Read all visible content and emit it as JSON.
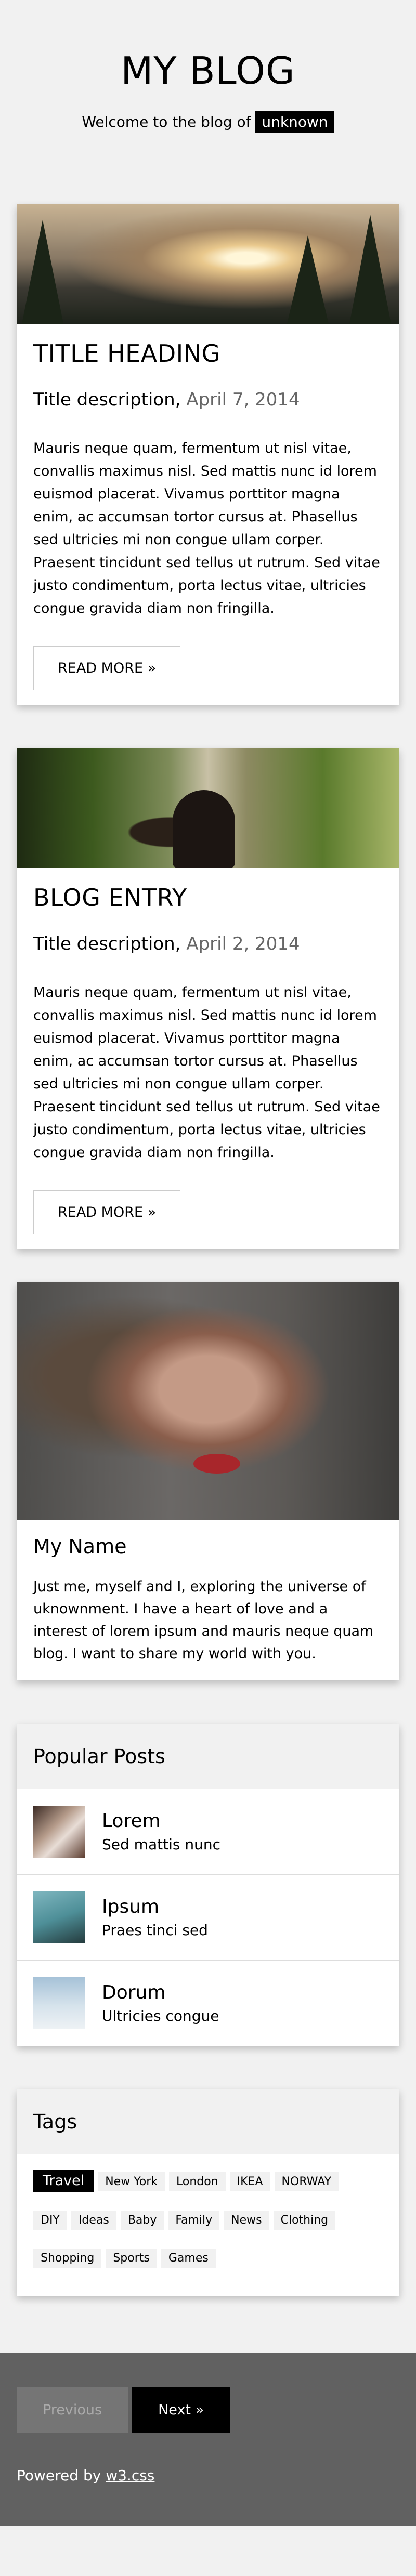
{
  "header": {
    "title": "MY BLOG",
    "welcome_text": "Welcome to the blog of",
    "user_badge": "unknown"
  },
  "entries": [
    {
      "title": "TITLE HEADING",
      "subtitle": "Title description,",
      "date": "April 7, 2014",
      "body": "Mauris neque quam, fermentum ut nisl vitae, convallis maximus nisl. Sed mattis nunc id lorem euismod placerat. Vivamus porttitor magna enim, ac accumsan tortor cursus at. Phasellus sed ultricies mi non congue ullam corper. Praesent tincidunt sed tellus ut rutrum. Sed vitae justo condimentum, porta lectus vitae, ultricies congue gravida diam non fringilla.",
      "button": "READ MORE »"
    },
    {
      "title": "BLOG ENTRY",
      "subtitle": "Title description,",
      "date": "April 2, 2014",
      "body": "Mauris neque quam, fermentum ut nisl vitae, convallis maximus nisl. Sed mattis nunc id lorem euismod placerat. Vivamus porttitor magna enim, ac accumsan tortor cursus at. Phasellus sed ultricies mi non congue ullam corper. Praesent tincidunt sed tellus ut rutrum. Sed vitae justo condimentum, porta lectus vitae, ultricies congue gravida diam non fringilla.",
      "button": "READ MORE »"
    }
  ],
  "profile": {
    "name": "My Name",
    "bio": "Just me, myself and I, exploring the universe of uknownment. I have a heart of love and a interest of lorem ipsum and mauris neque quam blog. I want to share my world with you."
  },
  "popular_posts": {
    "heading": "Popular Posts",
    "items": [
      {
        "title": "Lorem",
        "subtitle": "Sed mattis nunc"
      },
      {
        "title": "Ipsum",
        "subtitle": "Praes tinci sed"
      },
      {
        "title": "Dorum",
        "subtitle": "Ultricies congue"
      }
    ]
  },
  "tags": {
    "heading": "Tags",
    "items": [
      "Travel",
      "New York",
      "London",
      "IKEA",
      "NORWAY",
      "DIY",
      "Ideas",
      "Baby",
      "Family",
      "News",
      "Clothing",
      "Shopping",
      "Sports",
      "Games"
    ]
  },
  "footer": {
    "prev_label": "Previous",
    "next_label": "Next »",
    "powered_text": "Powered by",
    "powered_link": "w3.css"
  }
}
